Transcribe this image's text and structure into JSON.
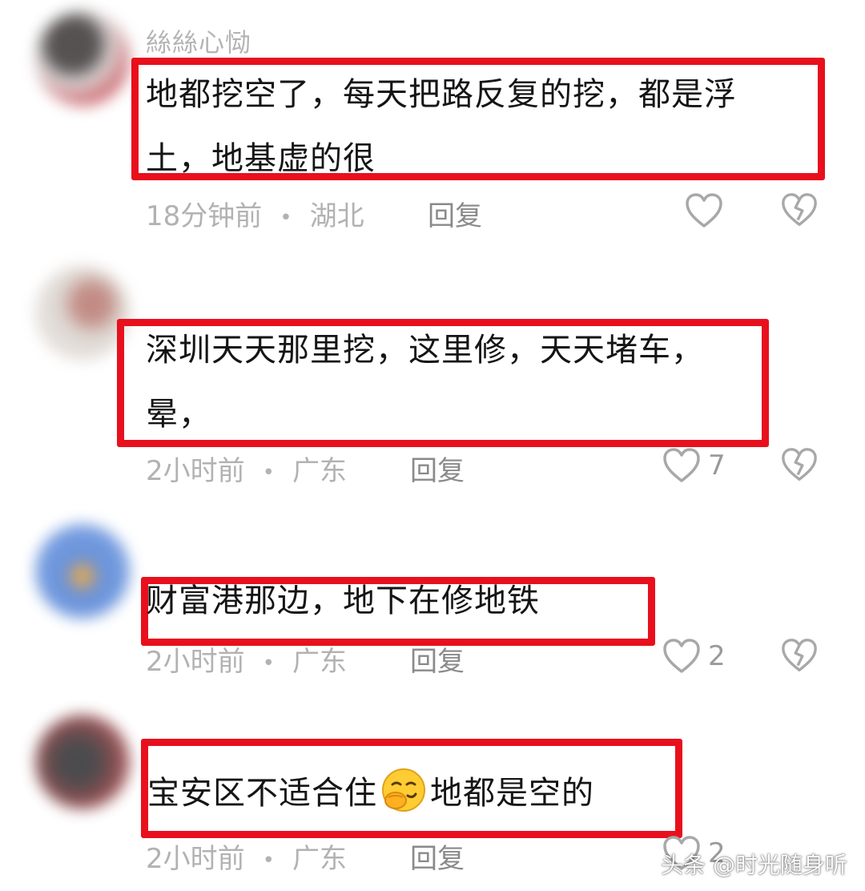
{
  "comments": [
    {
      "username": "絲絲心恸",
      "lines": [
        "地都挖空了，每天把路反复的挖，都是浮",
        "土，地基虚的很"
      ],
      "time": "18分钟前",
      "location": "湖北",
      "reply_label": "回复",
      "likes": "",
      "avatar_colors": [
        "#3a3434",
        "#d9d6d4",
        "#c2404a"
      ]
    },
    {
      "username": "",
      "lines": [
        "深圳天天那里挖，这里修，天天堵车，",
        "晕，"
      ],
      "time": "2小时前",
      "location": "广东",
      "reply_label": "回复",
      "likes": "7",
      "avatar_colors": [
        "#d8d2cc",
        "#e9e4df",
        "#b87870"
      ]
    },
    {
      "username": "",
      "lines": [
        "财富港那边，地下在修地铁"
      ],
      "time": "2小时前",
      "location": "广东",
      "reply_label": "回复",
      "likes": "2",
      "avatar_colors": [
        "#4f7fd4",
        "#6c98e0",
        "#d99a3a"
      ]
    },
    {
      "username": "",
      "line_before_emoji": "宝安区不适合住",
      "emoji": "smirking-face-with-hand-over-mouth",
      "line_after_emoji": "地都是空的",
      "time": "2小时前",
      "location": "广东",
      "reply_label": "回复",
      "likes": "2",
      "avatar_colors": [
        "#5a2e30",
        "#b04448",
        "#2c2c30"
      ]
    }
  ],
  "watermark": "头条 @时光随身听",
  "colors": {
    "highlight_box": "#e8101c",
    "meta_text": "#b2b2b2",
    "icon_stroke": "#a8a8a8"
  },
  "icons": {
    "like": "heart-outline-icon",
    "dislike": "broken-heart-icon"
  }
}
